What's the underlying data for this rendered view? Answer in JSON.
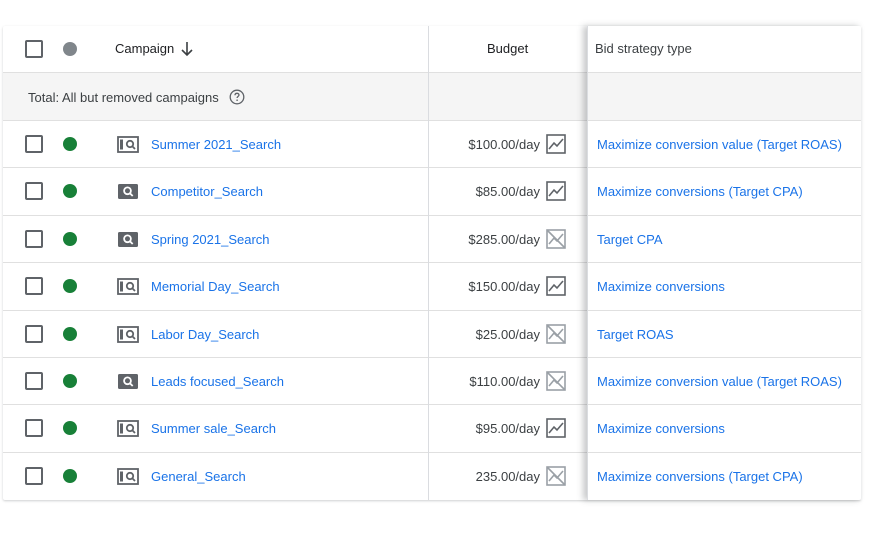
{
  "header": {
    "campaign_label": "Campaign",
    "budget_label": "Budget",
    "bid_label": "Bid strategy type"
  },
  "total": {
    "label": "Total: All but removed campaigns"
  },
  "rows": [
    {
      "name": "Summer 2021_Search",
      "budget": "$100.00/day",
      "bid": "Maximize conversion value (Target ROAS)",
      "type_icon": "search-campaign-framed-icon",
      "chart_icon": "trend-chart-icon"
    },
    {
      "name": "Competitor_Search",
      "budget": "$85.00/day",
      "bid": "Maximize conversions (Target CPA)",
      "type_icon": "search-campaign-solid-icon",
      "chart_icon": "trend-chart-icon"
    },
    {
      "name": "Spring 2021_Search",
      "budget": "$285.00/day",
      "bid": "Target CPA",
      "type_icon": "search-campaign-solid-icon",
      "chart_icon": "trend-chart-disabled-icon"
    },
    {
      "name": "Memorial Day_Search",
      "budget": "$150.00/day",
      "bid": "Maximize conversions",
      "type_icon": "search-campaign-framed-icon",
      "chart_icon": "trend-chart-icon"
    },
    {
      "name": "Labor Day_Search",
      "budget": "$25.00/day",
      "bid": "Target ROAS",
      "type_icon": "search-campaign-framed-icon",
      "chart_icon": "trend-chart-disabled-icon"
    },
    {
      "name": "Leads focused_Search",
      "budget": "$110.00/day",
      "bid": "Maximize conversion value (Target ROAS)",
      "type_icon": "search-campaign-solid-icon",
      "chart_icon": "trend-chart-disabled-icon"
    },
    {
      "name": "Summer sale_Search",
      "budget": "$95.00/day",
      "bid": "Maximize conversions",
      "type_icon": "search-campaign-framed-icon",
      "chart_icon": "trend-chart-icon"
    },
    {
      "name": "General_Search",
      "budget": "235.00/day",
      "bid": "Maximize conversions (Target CPA)",
      "type_icon": "search-campaign-framed-icon",
      "chart_icon": "trend-chart-disabled-icon"
    }
  ],
  "colors": {
    "status_enabled": "#188038",
    "link": "#1a73e8",
    "status_header": "#80868b"
  }
}
